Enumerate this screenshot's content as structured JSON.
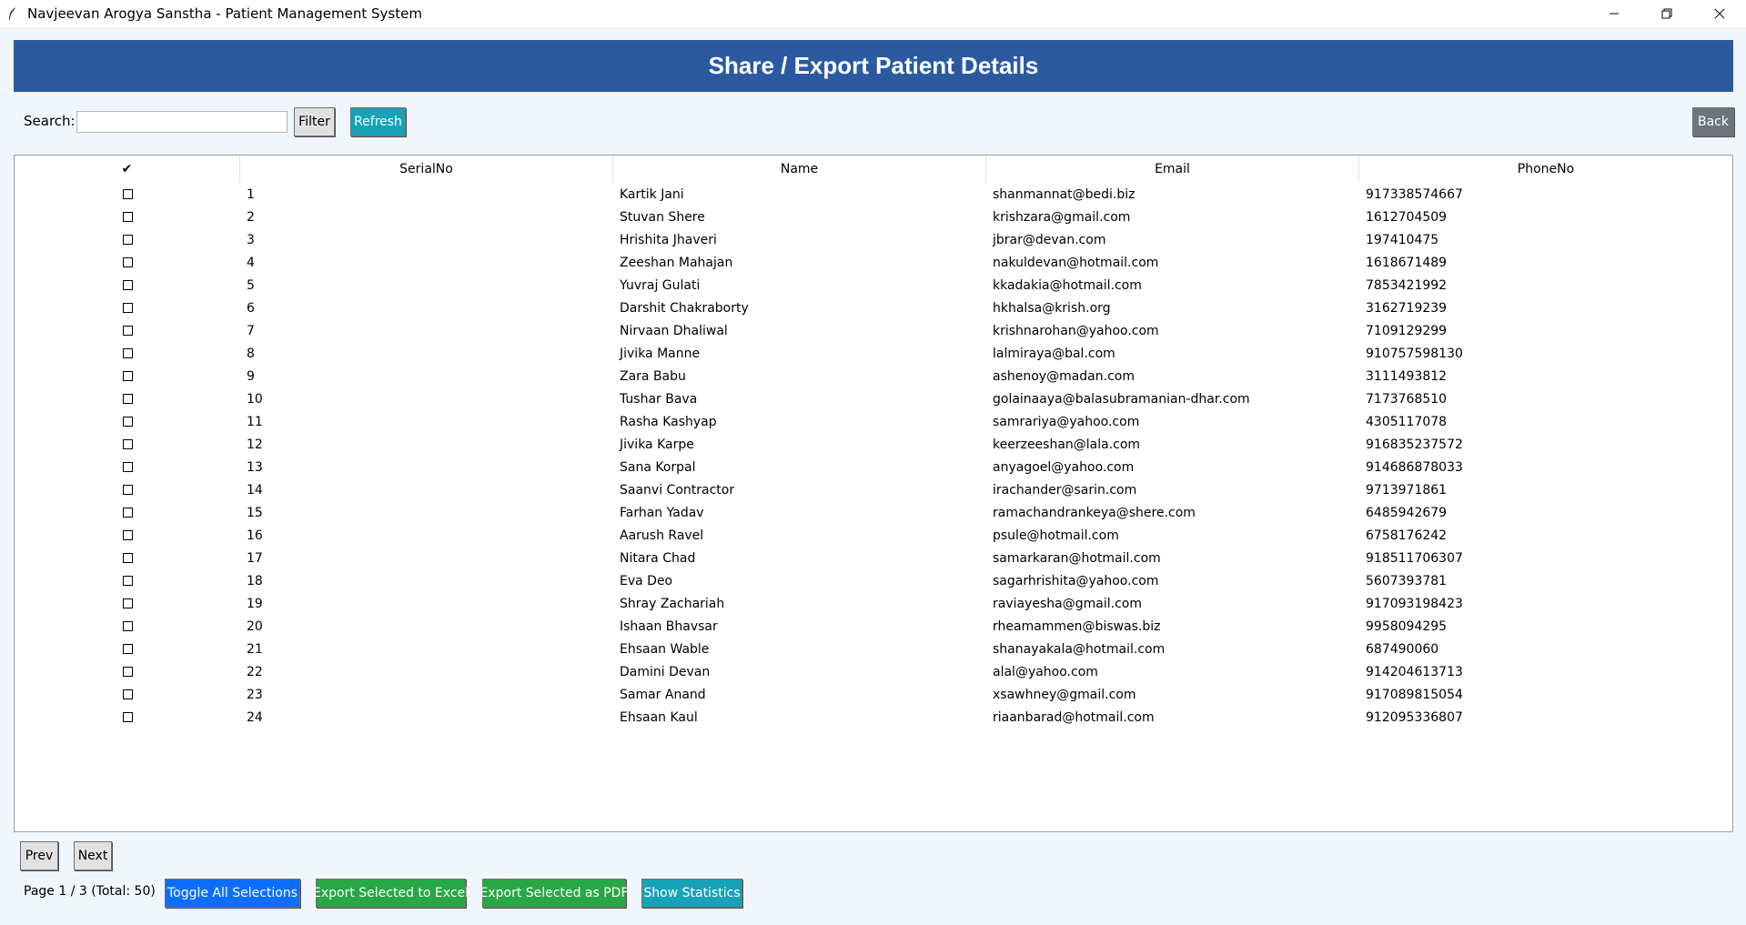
{
  "window": {
    "title": "Navjeevan Arogya Sanstha - Patient Management System",
    "icon": "feather-icon"
  },
  "header": {
    "title": "Share / Export Patient Details",
    "color": "#2b5aa0"
  },
  "toolbar": {
    "search_label": "Search:",
    "search_value": "",
    "filter_label": "Filter",
    "refresh_label": "Refresh",
    "back_label": "Back"
  },
  "table": {
    "columns": [
      "✔",
      "SerialNo",
      "Name",
      "Email",
      "PhoneNo"
    ],
    "rows": [
      {
        "serial": "1",
        "name": "Kartik Jani",
        "email": "shanmannat@bedi.biz",
        "phone": "917338574667"
      },
      {
        "serial": "2",
        "name": "Stuvan Shere",
        "email": "krishzara@gmail.com",
        "phone": "1612704509"
      },
      {
        "serial": "3",
        "name": "Hrishita Jhaveri",
        "email": "jbrar@devan.com",
        "phone": "197410475"
      },
      {
        "serial": "4",
        "name": "Zeeshan Mahajan",
        "email": "nakuldevan@hotmail.com",
        "phone": "1618671489"
      },
      {
        "serial": "5",
        "name": "Yuvraj  Gulati",
        "email": "kkadakia@hotmail.com",
        "phone": "7853421992"
      },
      {
        "serial": "6",
        "name": "Darshit Chakraborty",
        "email": "hkhalsa@krish.org",
        "phone": "3162719239"
      },
      {
        "serial": "7",
        "name": "Nirvaan Dhaliwal",
        "email": "krishnarohan@yahoo.com",
        "phone": "7109129299"
      },
      {
        "serial": "8",
        "name": "Jivika Manne",
        "email": "lalmiraya@bal.com",
        "phone": "910757598130"
      },
      {
        "serial": "9",
        "name": "Zara Babu",
        "email": "ashenoy@madan.com",
        "phone": "3111493812"
      },
      {
        "serial": "10",
        "name": "Tushar Bava",
        "email": "golainaaya@balasubramanian-dhar.com",
        "phone": "7173768510"
      },
      {
        "serial": "11",
        "name": "Rasha Kashyap",
        "email": "samrariya@yahoo.com",
        "phone": "4305117078"
      },
      {
        "serial": "12",
        "name": "Jivika Karpe",
        "email": "keerzeeshan@lala.com",
        "phone": "916835237572"
      },
      {
        "serial": "13",
        "name": "Sana Korpal",
        "email": "anyagoel@yahoo.com",
        "phone": "914686878033"
      },
      {
        "serial": "14",
        "name": "Saanvi Contractor",
        "email": "irachander@sarin.com",
        "phone": "9713971861"
      },
      {
        "serial": "15",
        "name": "Farhan Yadav",
        "email": "ramachandrankeya@shere.com",
        "phone": "6485942679"
      },
      {
        "serial": "16",
        "name": "Aarush Ravel",
        "email": "psule@hotmail.com",
        "phone": "6758176242"
      },
      {
        "serial": "17",
        "name": "Nitara Chad",
        "email": "samarkaran@hotmail.com",
        "phone": "918511706307"
      },
      {
        "serial": "18",
        "name": "Eva Deo",
        "email": "sagarhrishita@yahoo.com",
        "phone": "5607393781"
      },
      {
        "serial": "19",
        "name": "Shray Zachariah",
        "email": "raviayesha@gmail.com",
        "phone": "917093198423"
      },
      {
        "serial": "20",
        "name": "Ishaan Bhavsar",
        "email": "rheamammen@biswas.biz",
        "phone": "9958094295"
      },
      {
        "serial": "21",
        "name": "Ehsaan Wable",
        "email": "shanayakala@hotmail.com",
        "phone": "687490060"
      },
      {
        "serial": "22",
        "name": "Damini Devan",
        "email": "alal@yahoo.com",
        "phone": "914204613713"
      },
      {
        "serial": "23",
        "name": "Samar Anand",
        "email": "xsawhney@gmail.com",
        "phone": "917089815054"
      },
      {
        "serial": "24",
        "name": "Ehsaan Kaul",
        "email": "riaanbarad@hotmail.com",
        "phone": "912095336807"
      }
    ]
  },
  "pagination": {
    "prev_label": "Prev",
    "next_label": "Next",
    "page_info": "Page 1 / 3 (Total: 50)"
  },
  "actions": {
    "toggle_all_label": "Toggle All Selections",
    "export_excel_label": "Export Selected to Excel",
    "export_pdf_label": "Export Selected as PDF",
    "show_stats_label": "Show Statistics"
  }
}
